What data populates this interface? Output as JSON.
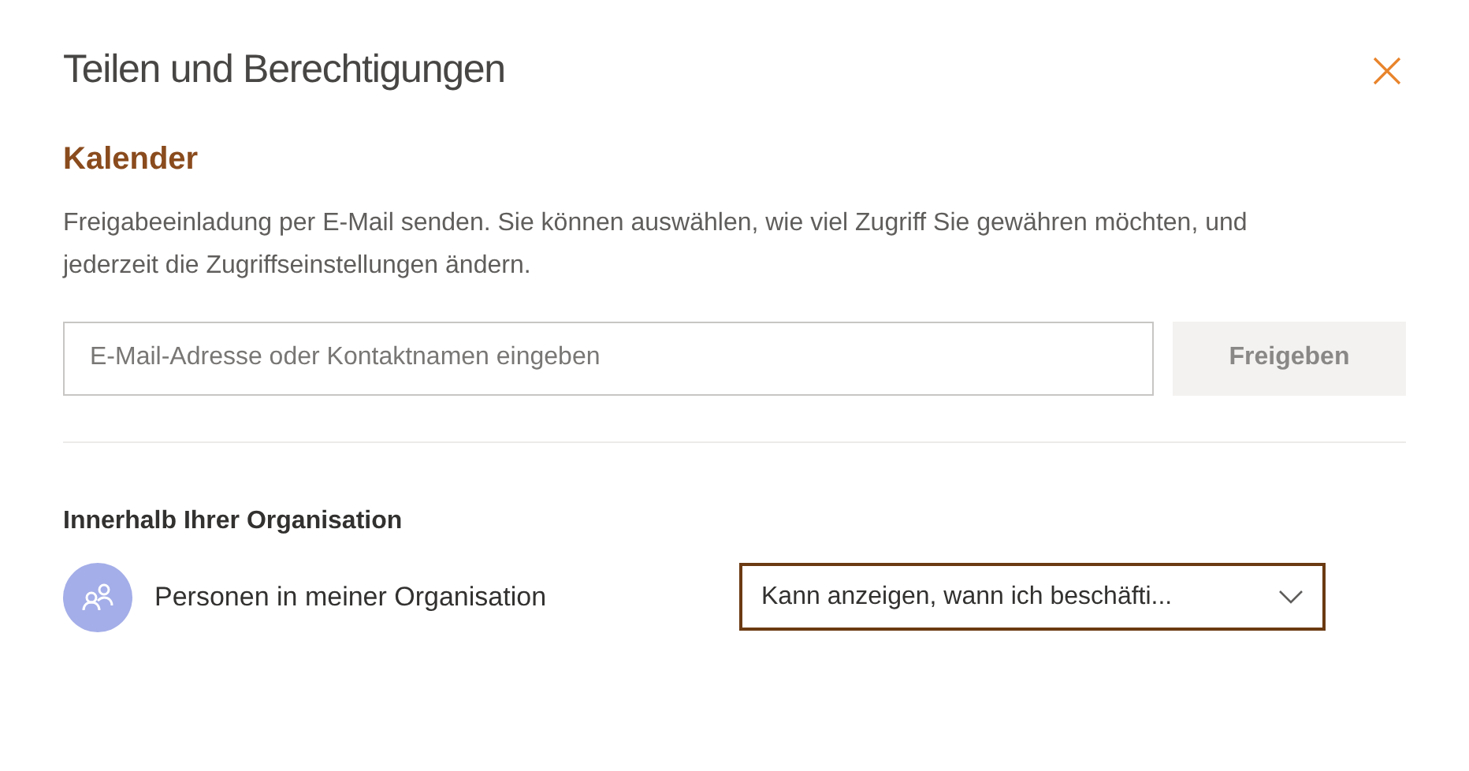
{
  "dialog": {
    "title": "Teilen und Berechtigungen"
  },
  "section": {
    "title": "Kalender",
    "description": "Freigabeeinladung per E-Mail senden. Sie können auswählen, wie viel Zugriff Sie gewähren möchten, und jederzeit die Zugriffseinstellungen ändern."
  },
  "invite": {
    "placeholder": "E-Mail-Adresse oder Kontaktnamen eingeben",
    "button": {
      "label": "Freigeben",
      "disabled": true
    }
  },
  "organization": {
    "heading": "Innerhalb Ihrer Organisation",
    "entries": [
      {
        "name": "Personen in meiner Organisation",
        "permission": "Kann anzeigen, wann ich beschäfti...",
        "focused": true
      }
    ]
  }
}
